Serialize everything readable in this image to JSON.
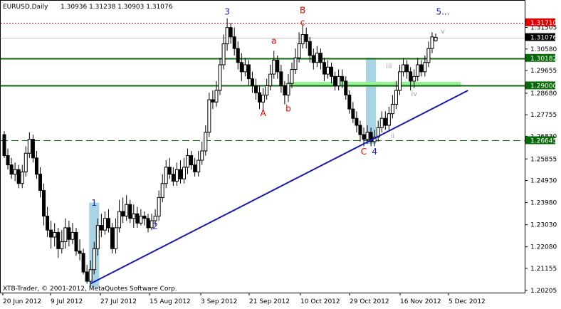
{
  "chart_data": {
    "type": "candlestick",
    "header": {
      "symbol": "EURUSD,Daily",
      "ohlc": "1.30936 1.31238 1.30903 1.31076"
    },
    "copyright": "XTB-Trader, © 2001-2012, MetaQuotes Software Corp.",
    "x_labels": [
      "20 Jun 2012",
      "9 Jul 2012",
      "27 Jul 2012",
      "15 Aug 2012",
      "3 Sep 2012",
      "21 Sep 2012",
      "10 Oct 2012",
      "29 Oct 2012",
      "16 Nov 2012",
      "5 Dec 2012"
    ],
    "y_ticks": [
      "1.31505",
      "1.30580",
      "1.29655",
      "1.28680",
      "1.27755",
      "1.26830",
      "1.25855",
      "1.24930",
      "1.23980",
      "1.23030",
      "1.22080",
      "1.21155",
      "1.20205"
    ],
    "ylim": [
      1.20205,
      1.325
    ],
    "price_labels": [
      {
        "text": "1.31710",
        "value": 1.3171,
        "bg": "#e00000"
      },
      {
        "text": "1.31076",
        "value": 1.31076,
        "bg": "#000000"
      },
      {
        "text": "1.30182",
        "value": 1.30182,
        "bg": "#0a6a0a"
      },
      {
        "text": "1.29000",
        "value": 1.29,
        "bg": "#0a6a0a"
      },
      {
        "text": "1.26645",
        "value": 1.26645,
        "bg": "#0a6a0a"
      }
    ],
    "levels": [
      {
        "value": 1.3171,
        "style": "dotted",
        "color": "#e00000"
      },
      {
        "value": 1.31076,
        "style": "solid",
        "color": "#c0c0c0"
      },
      {
        "value": 1.30182,
        "style": "solid",
        "color": "#0a6a0a"
      },
      {
        "value": 1.29,
        "style": "solid",
        "color": "#0a6a0a"
      },
      {
        "value": 1.26645,
        "style": "dashed",
        "color": "#0a6a0a"
      }
    ],
    "wave_labels": [
      {
        "text": "1",
        "color": "#2020c0",
        "bar": 25,
        "value": 1.2385
      },
      {
        "text": "2",
        "color": "#2020c0",
        "bar": 42,
        "value": 1.2285
      },
      {
        "text": "3",
        "color": "#2020c0",
        "bar": 62,
        "value": 1.3205
      },
      {
        "text": "A",
        "color": "#e00000",
        "bar": 72,
        "value": 1.277
      },
      {
        "text": "a",
        "color": "#e00000",
        "bar": 75,
        "value": 1.308
      },
      {
        "text": "b",
        "color": "#e00000",
        "bar": 79,
        "value": 1.279
      },
      {
        "text": "B",
        "color": "#e00000",
        "bar": 83,
        "value": 1.3212
      },
      {
        "text": "c",
        "color": "#e00000",
        "bar": 83,
        "value": 1.316
      },
      {
        "text": "C",
        "color": "#e00000",
        "bar": 100,
        "value": 1.2605
      },
      {
        "text": "4",
        "color": "#2020c0",
        "bar": 103,
        "value": 1.2605
      },
      {
        "text": "ii",
        "color": "#a0a0a0",
        "bar": 108,
        "value": 1.2675
      },
      {
        "text": "iii",
        "color": "#a0a0a0",
        "bar": 107,
        "value": 1.2975
      },
      {
        "text": "iv",
        "color": "#a0a0a0",
        "bar": 114,
        "value": 1.2855
      },
      {
        "text": "v",
        "color": "#a0a0a0",
        "bar": 122,
        "value": 1.3125
      },
      {
        "text": "5...",
        "color": "#2020c0",
        "bar": 122,
        "value": 1.3205
      }
    ],
    "candles": [
      [
        1.269,
        1.26,
        1.2705,
        1.259
      ],
      [
        1.26,
        1.256,
        1.263,
        1.254
      ],
      [
        1.256,
        1.252,
        1.259,
        1.25
      ],
      [
        1.252,
        1.254,
        1.257,
        1.249
      ],
      [
        1.254,
        1.248,
        1.256,
        1.246
      ],
      [
        1.248,
        1.253,
        1.256,
        1.246
      ],
      [
        1.253,
        1.261,
        1.264,
        1.251
      ],
      [
        1.261,
        1.267,
        1.27,
        1.259
      ],
      [
        1.267,
        1.259,
        1.269,
        1.257
      ],
      [
        1.259,
        1.252,
        1.262,
        1.25
      ],
      [
        1.252,
        1.245,
        1.255,
        1.242
      ],
      [
        1.245,
        1.234,
        1.248,
        1.23
      ],
      [
        1.234,
        1.228,
        1.238,
        1.225
      ],
      [
        1.228,
        1.225,
        1.232,
        1.22
      ],
      [
        1.225,
        1.227,
        1.231,
        1.221
      ],
      [
        1.227,
        1.22,
        1.229,
        1.216
      ],
      [
        1.22,
        1.223,
        1.228,
        1.218
      ],
      [
        1.223,
        1.229,
        1.233,
        1.22
      ],
      [
        1.229,
        1.224,
        1.232,
        1.221
      ],
      [
        1.224,
        1.227,
        1.231,
        1.222
      ],
      [
        1.227,
        1.219,
        1.229,
        1.217
      ],
      [
        1.219,
        1.218,
        1.224,
        1.215
      ],
      [
        1.218,
        1.21,
        1.22,
        1.209
      ],
      [
        1.21,
        1.206,
        1.213,
        1.205
      ],
      [
        1.206,
        1.211,
        1.215,
        1.204
      ],
      [
        1.211,
        1.22,
        1.223,
        1.209
      ],
      [
        1.22,
        1.23,
        1.233,
        1.217
      ],
      [
        1.23,
        1.228,
        1.235,
        1.225
      ],
      [
        1.228,
        1.233,
        1.236,
        1.226
      ],
      [
        1.233,
        1.229,
        1.237,
        1.227
      ],
      [
        1.229,
        1.22,
        1.231,
        1.218
      ],
      [
        1.22,
        1.229,
        1.233,
        1.218
      ],
      [
        1.229,
        1.236,
        1.241,
        1.227
      ],
      [
        1.236,
        1.234,
        1.242,
        1.231
      ],
      [
        1.234,
        1.239,
        1.243,
        1.232
      ],
      [
        1.239,
        1.233,
        1.241,
        1.231
      ],
      [
        1.233,
        1.235,
        1.239,
        1.229
      ],
      [
        1.235,
        1.231,
        1.238,
        1.229
      ],
      [
        1.231,
        1.234,
        1.237,
        1.23
      ],
      [
        1.234,
        1.233,
        1.236,
        1.23
      ],
      [
        1.233,
        1.229,
        1.235,
        1.227
      ],
      [
        1.229,
        1.232,
        1.235,
        1.228
      ],
      [
        1.232,
        1.234,
        1.237,
        1.23
      ],
      [
        1.234,
        1.242,
        1.245,
        1.232
      ],
      [
        1.242,
        1.248,
        1.252,
        1.24
      ],
      [
        1.248,
        1.255,
        1.258,
        1.246
      ],
      [
        1.255,
        1.252,
        1.259,
        1.25
      ],
      [
        1.252,
        1.249,
        1.255,
        1.247
      ],
      [
        1.249,
        1.254,
        1.257,
        1.247
      ],
      [
        1.254,
        1.25,
        1.258,
        1.248
      ],
      [
        1.25,
        1.255,
        1.259,
        1.248
      ],
      [
        1.255,
        1.26,
        1.263,
        1.252
      ],
      [
        1.26,
        1.256,
        1.262,
        1.254
      ],
      [
        1.256,
        1.253,
        1.259,
        1.251
      ],
      [
        1.253,
        1.258,
        1.262,
        1.251
      ],
      [
        1.258,
        1.262,
        1.266,
        1.256
      ],
      [
        1.262,
        1.27,
        1.273,
        1.26
      ],
      [
        1.27,
        1.284,
        1.287,
        1.268
      ],
      [
        1.284,
        1.283,
        1.288,
        1.28
      ],
      [
        1.283,
        1.288,
        1.292,
        1.281
      ],
      [
        1.288,
        1.299,
        1.302,
        1.286
      ],
      [
        1.299,
        1.308,
        1.312,
        1.297
      ],
      [
        1.308,
        1.315,
        1.319,
        1.305
      ],
      [
        1.315,
        1.311,
        1.317,
        1.308
      ],
      [
        1.311,
        1.306,
        1.315,
        1.303
      ],
      [
        1.306,
        1.3,
        1.309,
        1.297
      ],
      [
        1.3,
        1.296,
        1.304,
        1.292
      ],
      [
        1.296,
        1.299,
        1.302,
        1.294
      ],
      [
        1.299,
        1.293,
        1.301,
        1.29
      ],
      [
        1.293,
        1.29,
        1.296,
        1.287
      ],
      [
        1.29,
        1.287,
        1.293,
        1.284
      ],
      [
        1.287,
        1.283,
        1.29,
        1.28
      ],
      [
        1.283,
        1.286,
        1.289,
        1.279
      ],
      [
        1.286,
        1.29,
        1.293,
        1.284
      ],
      [
        1.29,
        1.295,
        1.299,
        1.288
      ],
      [
        1.295,
        1.301,
        1.305,
        1.293
      ],
      [
        1.301,
        1.296,
        1.303,
        1.293
      ],
      [
        1.296,
        1.29,
        1.299,
        1.287
      ],
      [
        1.29,
        1.286,
        1.292,
        1.282
      ],
      [
        1.286,
        1.291,
        1.295,
        1.283
      ],
      [
        1.291,
        1.297,
        1.3,
        1.289
      ],
      [
        1.297,
        1.302,
        1.306,
        1.295
      ],
      [
        1.302,
        1.308,
        1.313,
        1.3
      ],
      [
        1.308,
        1.312,
        1.316,
        1.306
      ],
      [
        1.312,
        1.309,
        1.315,
        1.306
      ],
      [
        1.309,
        1.303,
        1.311,
        1.3
      ],
      [
        1.303,
        1.3,
        1.306,
        1.297
      ],
      [
        1.3,
        1.304,
        1.307,
        1.298
      ],
      [
        1.304,
        1.3,
        1.306,
        1.297
      ],
      [
        1.3,
        1.295,
        1.302,
        1.292
      ],
      [
        1.295,
        1.298,
        1.301,
        1.293
      ],
      [
        1.298,
        1.294,
        1.3,
        1.291
      ],
      [
        1.294,
        1.29,
        1.296,
        1.288
      ],
      [
        1.29,
        1.294,
        1.297,
        1.288
      ],
      [
        1.294,
        1.292,
        1.297,
        1.289
      ],
      [
        1.292,
        1.286,
        1.294,
        1.284
      ],
      [
        1.286,
        1.28,
        1.288,
        1.278
      ],
      [
        1.28,
        1.276,
        1.283,
        1.274
      ],
      [
        1.276,
        1.273,
        1.279,
        1.27
      ],
      [
        1.273,
        1.269,
        1.275,
        1.266
      ],
      [
        1.269,
        1.267,
        1.272,
        1.264
      ],
      [
        1.267,
        1.27,
        1.273,
        1.265
      ],
      [
        1.27,
        1.266,
        1.272,
        1.264
      ],
      [
        1.266,
        1.268,
        1.271,
        1.264
      ],
      [
        1.268,
        1.272,
        1.275,
        1.266
      ],
      [
        1.272,
        1.276,
        1.279,
        1.27
      ],
      [
        1.276,
        1.273,
        1.279,
        1.271
      ],
      [
        1.273,
        1.278,
        1.281,
        1.271
      ],
      [
        1.278,
        1.282,
        1.286,
        1.276
      ],
      [
        1.282,
        1.288,
        1.292,
        1.28
      ],
      [
        1.288,
        1.296,
        1.299,
        1.286
      ],
      [
        1.296,
        1.299,
        1.302,
        1.294
      ],
      [
        1.299,
        1.296,
        1.301,
        1.293
      ],
      [
        1.296,
        1.292,
        1.298,
        1.288
      ],
      [
        1.292,
        1.294,
        1.297,
        1.289
      ],
      [
        1.294,
        1.299,
        1.302,
        1.292
      ],
      [
        1.299,
        1.296,
        1.301,
        1.294
      ],
      [
        1.296,
        1.3,
        1.303,
        1.294
      ],
      [
        1.3,
        1.306,
        1.309,
        1.298
      ],
      [
        1.306,
        1.311,
        1.313,
        1.304
      ],
      [
        1.3093,
        1.3108,
        1.3124,
        1.309
      ]
    ],
    "trendline": {
      "start": {
        "bar": 24,
        "value": 1.205
      },
      "end": {
        "bar": 129,
        "value": 1.288
      },
      "color": "#1a1ab0"
    },
    "green_zone": {
      "from_bar": 79,
      "to_bar": 127,
      "top": 1.2908,
      "bottom": 1.2893,
      "color": "#99ee99"
    },
    "blue_boxes": [
      {
        "from_bar": 24,
        "to_bar": 26,
        "top": 1.2398,
        "bottom": 1.2035,
        "color": "#a8d4e6"
      },
      {
        "from_bar": 101,
        "to_bar": 103,
        "top": 1.302,
        "bottom": 1.265,
        "color": "#a8d4e6"
      }
    ]
  }
}
